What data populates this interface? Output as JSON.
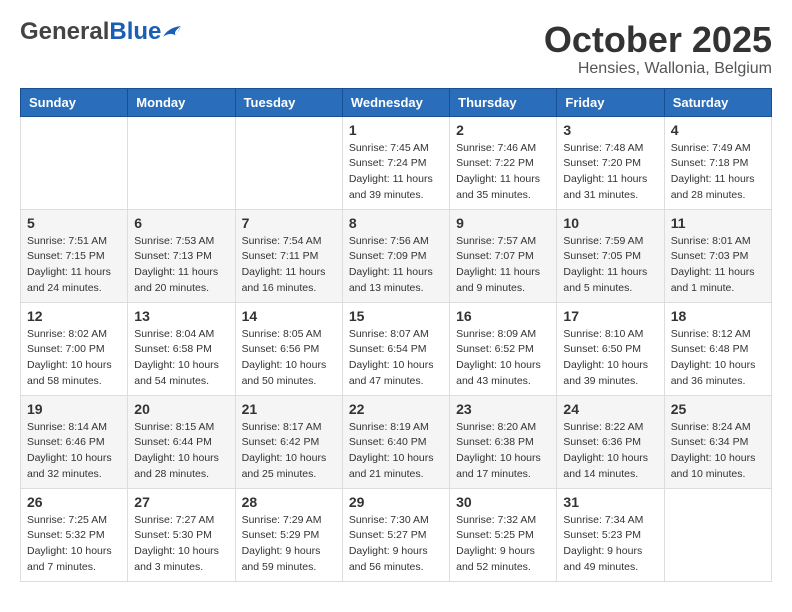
{
  "header": {
    "logo_general": "General",
    "logo_blue": "Blue",
    "month_title": "October 2025",
    "subtitle": "Hensies, Wallonia, Belgium"
  },
  "days_of_week": [
    "Sunday",
    "Monday",
    "Tuesday",
    "Wednesday",
    "Thursday",
    "Friday",
    "Saturday"
  ],
  "weeks": [
    [
      {
        "day": "",
        "info": ""
      },
      {
        "day": "",
        "info": ""
      },
      {
        "day": "",
        "info": ""
      },
      {
        "day": "1",
        "info": "Sunrise: 7:45 AM\nSunset: 7:24 PM\nDaylight: 11 hours\nand 39 minutes."
      },
      {
        "day": "2",
        "info": "Sunrise: 7:46 AM\nSunset: 7:22 PM\nDaylight: 11 hours\nand 35 minutes."
      },
      {
        "day": "3",
        "info": "Sunrise: 7:48 AM\nSunset: 7:20 PM\nDaylight: 11 hours\nand 31 minutes."
      },
      {
        "day": "4",
        "info": "Sunrise: 7:49 AM\nSunset: 7:18 PM\nDaylight: 11 hours\nand 28 minutes."
      }
    ],
    [
      {
        "day": "5",
        "info": "Sunrise: 7:51 AM\nSunset: 7:15 PM\nDaylight: 11 hours\nand 24 minutes."
      },
      {
        "day": "6",
        "info": "Sunrise: 7:53 AM\nSunset: 7:13 PM\nDaylight: 11 hours\nand 20 minutes."
      },
      {
        "day": "7",
        "info": "Sunrise: 7:54 AM\nSunset: 7:11 PM\nDaylight: 11 hours\nand 16 minutes."
      },
      {
        "day": "8",
        "info": "Sunrise: 7:56 AM\nSunset: 7:09 PM\nDaylight: 11 hours\nand 13 minutes."
      },
      {
        "day": "9",
        "info": "Sunrise: 7:57 AM\nSunset: 7:07 PM\nDaylight: 11 hours\nand 9 minutes."
      },
      {
        "day": "10",
        "info": "Sunrise: 7:59 AM\nSunset: 7:05 PM\nDaylight: 11 hours\nand 5 minutes."
      },
      {
        "day": "11",
        "info": "Sunrise: 8:01 AM\nSunset: 7:03 PM\nDaylight: 11 hours\nand 1 minute."
      }
    ],
    [
      {
        "day": "12",
        "info": "Sunrise: 8:02 AM\nSunset: 7:00 PM\nDaylight: 10 hours\nand 58 minutes."
      },
      {
        "day": "13",
        "info": "Sunrise: 8:04 AM\nSunset: 6:58 PM\nDaylight: 10 hours\nand 54 minutes."
      },
      {
        "day": "14",
        "info": "Sunrise: 8:05 AM\nSunset: 6:56 PM\nDaylight: 10 hours\nand 50 minutes."
      },
      {
        "day": "15",
        "info": "Sunrise: 8:07 AM\nSunset: 6:54 PM\nDaylight: 10 hours\nand 47 minutes."
      },
      {
        "day": "16",
        "info": "Sunrise: 8:09 AM\nSunset: 6:52 PM\nDaylight: 10 hours\nand 43 minutes."
      },
      {
        "day": "17",
        "info": "Sunrise: 8:10 AM\nSunset: 6:50 PM\nDaylight: 10 hours\nand 39 minutes."
      },
      {
        "day": "18",
        "info": "Sunrise: 8:12 AM\nSunset: 6:48 PM\nDaylight: 10 hours\nand 36 minutes."
      }
    ],
    [
      {
        "day": "19",
        "info": "Sunrise: 8:14 AM\nSunset: 6:46 PM\nDaylight: 10 hours\nand 32 minutes."
      },
      {
        "day": "20",
        "info": "Sunrise: 8:15 AM\nSunset: 6:44 PM\nDaylight: 10 hours\nand 28 minutes."
      },
      {
        "day": "21",
        "info": "Sunrise: 8:17 AM\nSunset: 6:42 PM\nDaylight: 10 hours\nand 25 minutes."
      },
      {
        "day": "22",
        "info": "Sunrise: 8:19 AM\nSunset: 6:40 PM\nDaylight: 10 hours\nand 21 minutes."
      },
      {
        "day": "23",
        "info": "Sunrise: 8:20 AM\nSunset: 6:38 PM\nDaylight: 10 hours\nand 17 minutes."
      },
      {
        "day": "24",
        "info": "Sunrise: 8:22 AM\nSunset: 6:36 PM\nDaylight: 10 hours\nand 14 minutes."
      },
      {
        "day": "25",
        "info": "Sunrise: 8:24 AM\nSunset: 6:34 PM\nDaylight: 10 hours\nand 10 minutes."
      }
    ],
    [
      {
        "day": "26",
        "info": "Sunrise: 7:25 AM\nSunset: 5:32 PM\nDaylight: 10 hours\nand 7 minutes."
      },
      {
        "day": "27",
        "info": "Sunrise: 7:27 AM\nSunset: 5:30 PM\nDaylight: 10 hours\nand 3 minutes."
      },
      {
        "day": "28",
        "info": "Sunrise: 7:29 AM\nSunset: 5:29 PM\nDaylight: 9 hours\nand 59 minutes."
      },
      {
        "day": "29",
        "info": "Sunrise: 7:30 AM\nSunset: 5:27 PM\nDaylight: 9 hours\nand 56 minutes."
      },
      {
        "day": "30",
        "info": "Sunrise: 7:32 AM\nSunset: 5:25 PM\nDaylight: 9 hours\nand 52 minutes."
      },
      {
        "day": "31",
        "info": "Sunrise: 7:34 AM\nSunset: 5:23 PM\nDaylight: 9 hours\nand 49 minutes."
      },
      {
        "day": "",
        "info": ""
      }
    ]
  ]
}
